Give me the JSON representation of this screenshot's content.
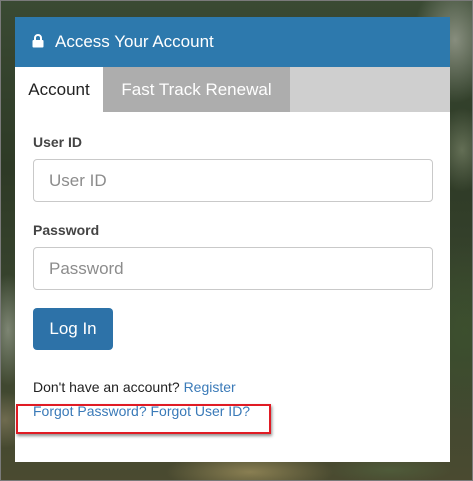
{
  "card": {
    "title": "Access Your Account",
    "lock_icon": "lock-icon"
  },
  "tabs": [
    {
      "label": "Account",
      "active": true
    },
    {
      "label": "Fast Track Renewal",
      "active": false
    }
  ],
  "form": {
    "user_id": {
      "label": "User ID",
      "placeholder": "User ID",
      "value": ""
    },
    "password": {
      "label": "Password",
      "placeholder": "Password",
      "value": ""
    },
    "login_button": "Log In"
  },
  "register": {
    "prompt": "Don't have an account?",
    "link": "Register"
  },
  "forgot": {
    "password_link": "Forgot Password?",
    "user_id_link": "Forgot User ID?"
  },
  "colors": {
    "header": "#2d79ad",
    "button": "#2d72a8",
    "link": "#3a7ab8",
    "highlight": "#e01b24",
    "inactive_tab": "#adadad"
  }
}
